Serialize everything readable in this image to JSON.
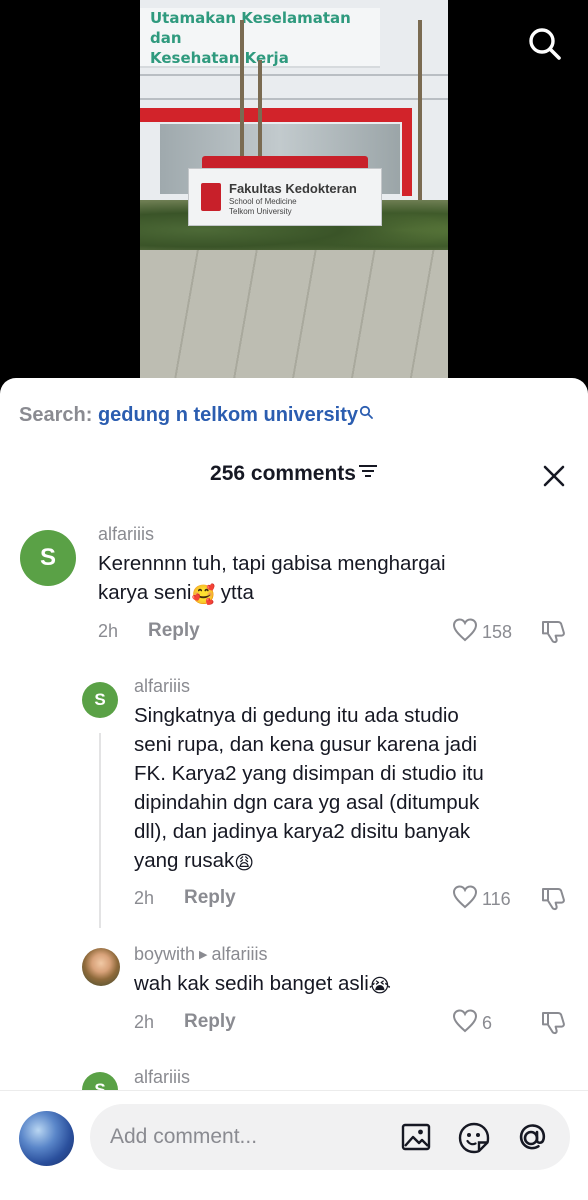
{
  "video": {
    "banner_line1": "Utamakan Keselamatan dan",
    "banner_line2": "Kesehatan Kerja",
    "sign_title": "Fakultas Kedokteran",
    "sign_sub1": "School of Medicine",
    "sign_sub2": "Telkom University"
  },
  "top_search_icon": "search-icon",
  "search": {
    "label": "Search:",
    "term": "gedung n telkom university"
  },
  "comments_header": {
    "count_label": "256 comments"
  },
  "comments": [
    {
      "avatar_letter": "S",
      "username": "alfariiis",
      "text_line1": "Kerennnn tuh, tapi gabisa menghargai",
      "text_line2_pre": "karya seni",
      "emoji": "🥰",
      "text_line2_post": " ytta",
      "time": "2h",
      "reply": "Reply",
      "likes": "158"
    },
    {
      "avatar_letter": "S",
      "username": "alfariiis",
      "lines": [
        "Singkatnya di gedung itu ada studio",
        "seni rupa, dan kena gusur karena jadi",
        "FK. Karya2 yang disimpan di studio itu",
        "dipindahin dgn cara yg asal (ditumpuk",
        "dll), dan jadinya karya2 disitu banyak"
      ],
      "last_line": "yang rusak",
      "emoji": "😩",
      "time": "2h",
      "reply": "Reply",
      "likes": "116"
    },
    {
      "username": "boywith",
      "reply_to": "alfariiis",
      "text": "wah kak sedih banget asli",
      "emoji": "😭",
      "time": "2h",
      "reply": "Reply",
      "likes": "6"
    },
    {
      "avatar_letter": "S",
      "username": "alfariiis"
    }
  ],
  "composer": {
    "placeholder": "Add comment..."
  },
  "colors": {
    "link_blue": "#2b5db0",
    "avatar_green": "#5aa146",
    "muted_gray": "#8a8b91"
  }
}
